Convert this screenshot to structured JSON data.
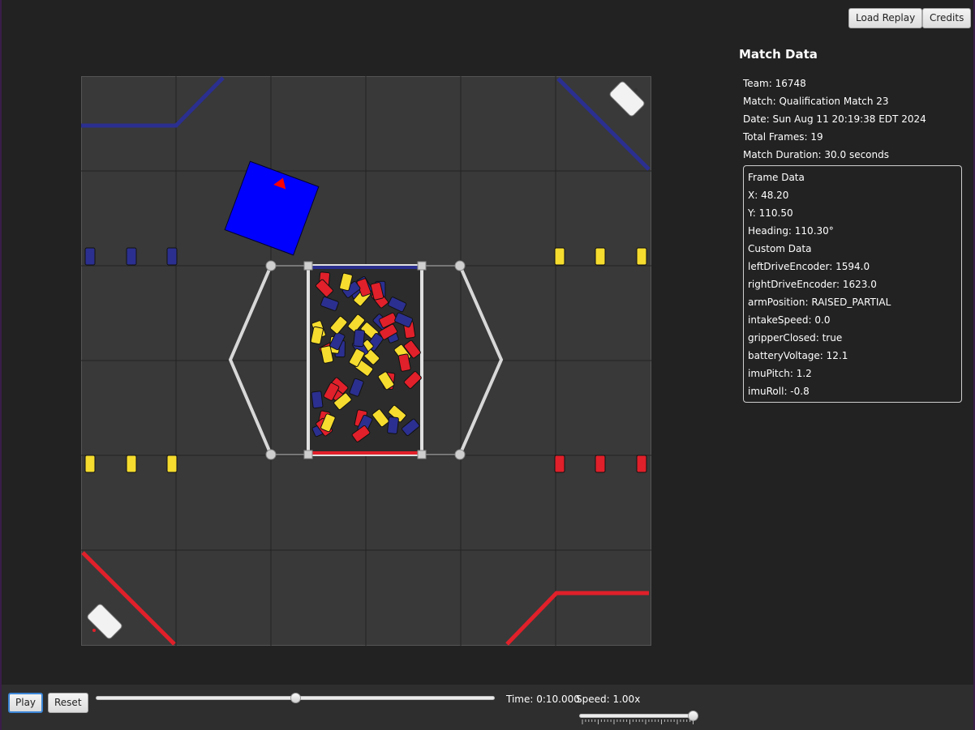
{
  "toolbar": {
    "load_replay_label": "Load Replay",
    "credits_label": "Credits"
  },
  "match": {
    "title": "Match Data",
    "team": "Team: 16748",
    "match": "Match: Qualification Match 23",
    "date": "Date: Sun Aug 11 20:19:38 EDT 2024",
    "total_frames": "Total Frames: 19",
    "duration": "Match Duration: 30.0 seconds"
  },
  "frame": {
    "header": "Frame Data",
    "x": "X: 48.20",
    "y": "Y: 110.50",
    "heading": "Heading: 110.30°",
    "custom_header": "Custom Data",
    "left_drive": "leftDriveEncoder: 1594.0",
    "right_drive": "rightDriveEncoder: 1623.0",
    "arm": "armPosition: RAISED_PARTIAL",
    "intake": "intakeSpeed: 0.0",
    "gripper": "gripperClosed: true",
    "battery": "batteryVoltage: 12.1",
    "pitch": "imuPitch: 1.2",
    "roll": "imuRoll: -0.8"
  },
  "playback": {
    "play_label": "Play",
    "reset_label": "Reset",
    "time": "Time: 0:10.000",
    "speed": "Speed: 1.00x",
    "timeline_progress": 0.5,
    "speed_progress": 1.0
  },
  "field": {
    "robot_heading_deg": 110.3,
    "colors": {
      "background": "#393939",
      "grid": "#222222",
      "blue": "#2b2f8f",
      "red": "#e0202a",
      "yellow": "#f5dc2e",
      "robot": "#0000ff",
      "robot_marker": "#ff0000"
    }
  }
}
